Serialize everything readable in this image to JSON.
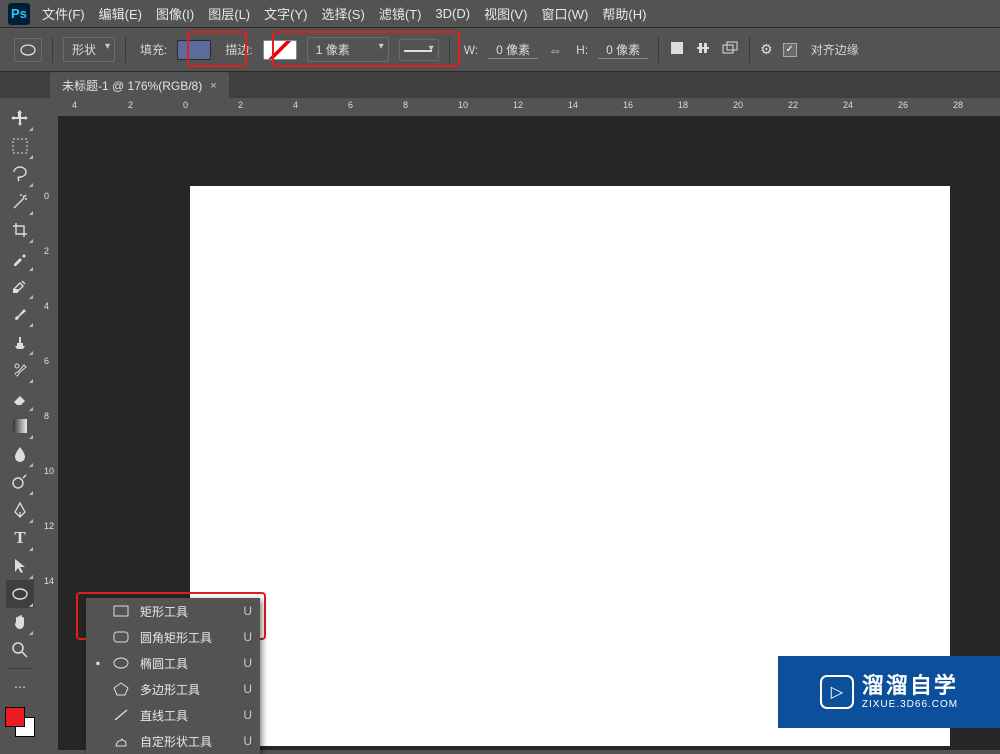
{
  "app": {
    "logo": "Ps"
  },
  "menubar": [
    "文件(F)",
    "编辑(E)",
    "图像(I)",
    "图层(L)",
    "文字(Y)",
    "选择(S)",
    "滤镜(T)",
    "3D(D)",
    "视图(V)",
    "窗口(W)",
    "帮助(H)"
  ],
  "options": {
    "mode": "形状",
    "fill_label": "填充:",
    "fill_color": "#5a6b9c",
    "stroke_label": "描边:",
    "stroke_color": "#b03030",
    "stroke_width": "1 像素",
    "w_label": "W:",
    "w_value": "0 像素",
    "h_label": "H:",
    "h_value": "0 像素",
    "align_label": "对齐边缘"
  },
  "tab": {
    "title": "未标题-1 @ 176%(RGB/8)"
  },
  "ruler_h": [
    "4",
    "2",
    "0",
    "2",
    "4",
    "6",
    "8",
    "10",
    "12",
    "14",
    "16",
    "18",
    "20",
    "22",
    "24",
    "26",
    "28"
  ],
  "ruler_v": [
    "0",
    "2",
    "4",
    "6",
    "8",
    "10",
    "12",
    "14"
  ],
  "flyout": {
    "items": [
      {
        "icon": "rect",
        "label": "矩形工具",
        "key": "U",
        "checked": false
      },
      {
        "icon": "roundrect",
        "label": "圆角矩形工具",
        "key": "U",
        "checked": false
      },
      {
        "icon": "ellipse",
        "label": "椭圆工具",
        "key": "U",
        "checked": true
      },
      {
        "icon": "polygon",
        "label": "多边形工具",
        "key": "U",
        "checked": false
      },
      {
        "icon": "line",
        "label": "直线工具",
        "key": "U",
        "checked": false
      },
      {
        "icon": "custom",
        "label": "自定形状工具",
        "key": "U",
        "checked": false
      }
    ]
  },
  "watermark": {
    "big": "溜溜自学",
    "small": "ZIXUE.3D66.COM"
  },
  "colors": {
    "foreground": "#ed1c24",
    "background": "#ffffff"
  }
}
